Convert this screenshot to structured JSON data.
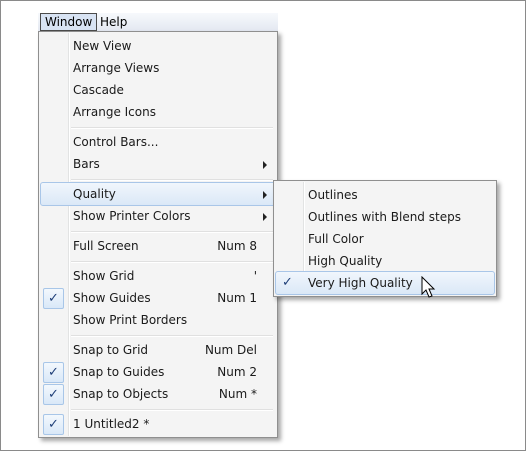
{
  "menubar": {
    "window_label": "Window",
    "help_label": "Help"
  },
  "window_menu": {
    "new_view": "New View",
    "arrange_views": "Arrange Views",
    "cascade": "Cascade",
    "arrange_icons": "Arrange Icons",
    "control_bars": "Control Bars...",
    "bars": "Bars",
    "quality": "Quality",
    "show_printer_colors": "Show Printer Colors",
    "full_screen": "Full Screen",
    "full_screen_shortcut": "Num 8",
    "show_grid": "Show Grid",
    "show_grid_shortcut": "'",
    "show_guides": "Show Guides",
    "show_guides_shortcut": "Num 1",
    "show_print_borders": "Show Print Borders",
    "snap_to_grid": "Snap to Grid",
    "snap_to_grid_shortcut": "Num Del",
    "snap_to_guides": "Snap to Guides",
    "snap_to_guides_shortcut": "Num 2",
    "snap_to_objects": "Snap to Objects",
    "snap_to_objects_shortcut": "Num *",
    "untitled": "1 Untitled2 *"
  },
  "quality_menu": {
    "outlines": "Outlines",
    "outlines_blend": "Outlines with Blend steps",
    "full_color": "Full Color",
    "high_quality": "High Quality",
    "very_high_quality": "Very High Quality"
  },
  "check_glyph": "✓",
  "colors": {
    "highlight": "#dbe8f7",
    "highlight_border": "#a9c6e8",
    "check": "#1f3f78"
  }
}
